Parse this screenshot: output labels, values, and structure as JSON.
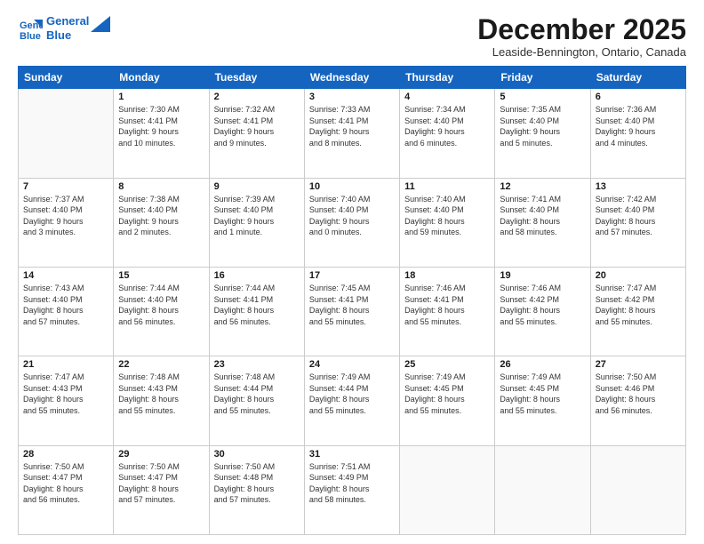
{
  "logo": {
    "line1": "General",
    "line2": "Blue"
  },
  "title": "December 2025",
  "location": "Leaside-Bennington, Ontario, Canada",
  "days_header": [
    "Sunday",
    "Monday",
    "Tuesday",
    "Wednesday",
    "Thursday",
    "Friday",
    "Saturday"
  ],
  "weeks": [
    [
      {
        "day": "",
        "info": ""
      },
      {
        "day": "1",
        "info": "Sunrise: 7:30 AM\nSunset: 4:41 PM\nDaylight: 9 hours\nand 10 minutes."
      },
      {
        "day": "2",
        "info": "Sunrise: 7:32 AM\nSunset: 4:41 PM\nDaylight: 9 hours\nand 9 minutes."
      },
      {
        "day": "3",
        "info": "Sunrise: 7:33 AM\nSunset: 4:41 PM\nDaylight: 9 hours\nand 8 minutes."
      },
      {
        "day": "4",
        "info": "Sunrise: 7:34 AM\nSunset: 4:40 PM\nDaylight: 9 hours\nand 6 minutes."
      },
      {
        "day": "5",
        "info": "Sunrise: 7:35 AM\nSunset: 4:40 PM\nDaylight: 9 hours\nand 5 minutes."
      },
      {
        "day": "6",
        "info": "Sunrise: 7:36 AM\nSunset: 4:40 PM\nDaylight: 9 hours\nand 4 minutes."
      }
    ],
    [
      {
        "day": "7",
        "info": "Sunrise: 7:37 AM\nSunset: 4:40 PM\nDaylight: 9 hours\nand 3 minutes."
      },
      {
        "day": "8",
        "info": "Sunrise: 7:38 AM\nSunset: 4:40 PM\nDaylight: 9 hours\nand 2 minutes."
      },
      {
        "day": "9",
        "info": "Sunrise: 7:39 AM\nSunset: 4:40 PM\nDaylight: 9 hours\nand 1 minute."
      },
      {
        "day": "10",
        "info": "Sunrise: 7:40 AM\nSunset: 4:40 PM\nDaylight: 9 hours\nand 0 minutes."
      },
      {
        "day": "11",
        "info": "Sunrise: 7:40 AM\nSunset: 4:40 PM\nDaylight: 8 hours\nand 59 minutes."
      },
      {
        "day": "12",
        "info": "Sunrise: 7:41 AM\nSunset: 4:40 PM\nDaylight: 8 hours\nand 58 minutes."
      },
      {
        "day": "13",
        "info": "Sunrise: 7:42 AM\nSunset: 4:40 PM\nDaylight: 8 hours\nand 57 minutes."
      }
    ],
    [
      {
        "day": "14",
        "info": "Sunrise: 7:43 AM\nSunset: 4:40 PM\nDaylight: 8 hours\nand 57 minutes."
      },
      {
        "day": "15",
        "info": "Sunrise: 7:44 AM\nSunset: 4:40 PM\nDaylight: 8 hours\nand 56 minutes."
      },
      {
        "day": "16",
        "info": "Sunrise: 7:44 AM\nSunset: 4:41 PM\nDaylight: 8 hours\nand 56 minutes."
      },
      {
        "day": "17",
        "info": "Sunrise: 7:45 AM\nSunset: 4:41 PM\nDaylight: 8 hours\nand 55 minutes."
      },
      {
        "day": "18",
        "info": "Sunrise: 7:46 AM\nSunset: 4:41 PM\nDaylight: 8 hours\nand 55 minutes."
      },
      {
        "day": "19",
        "info": "Sunrise: 7:46 AM\nSunset: 4:42 PM\nDaylight: 8 hours\nand 55 minutes."
      },
      {
        "day": "20",
        "info": "Sunrise: 7:47 AM\nSunset: 4:42 PM\nDaylight: 8 hours\nand 55 minutes."
      }
    ],
    [
      {
        "day": "21",
        "info": "Sunrise: 7:47 AM\nSunset: 4:43 PM\nDaylight: 8 hours\nand 55 minutes."
      },
      {
        "day": "22",
        "info": "Sunrise: 7:48 AM\nSunset: 4:43 PM\nDaylight: 8 hours\nand 55 minutes."
      },
      {
        "day": "23",
        "info": "Sunrise: 7:48 AM\nSunset: 4:44 PM\nDaylight: 8 hours\nand 55 minutes."
      },
      {
        "day": "24",
        "info": "Sunrise: 7:49 AM\nSunset: 4:44 PM\nDaylight: 8 hours\nand 55 minutes."
      },
      {
        "day": "25",
        "info": "Sunrise: 7:49 AM\nSunset: 4:45 PM\nDaylight: 8 hours\nand 55 minutes."
      },
      {
        "day": "26",
        "info": "Sunrise: 7:49 AM\nSunset: 4:45 PM\nDaylight: 8 hours\nand 55 minutes."
      },
      {
        "day": "27",
        "info": "Sunrise: 7:50 AM\nSunset: 4:46 PM\nDaylight: 8 hours\nand 56 minutes."
      }
    ],
    [
      {
        "day": "28",
        "info": "Sunrise: 7:50 AM\nSunset: 4:47 PM\nDaylight: 8 hours\nand 56 minutes."
      },
      {
        "day": "29",
        "info": "Sunrise: 7:50 AM\nSunset: 4:47 PM\nDaylight: 8 hours\nand 57 minutes."
      },
      {
        "day": "30",
        "info": "Sunrise: 7:50 AM\nSunset: 4:48 PM\nDaylight: 8 hours\nand 57 minutes."
      },
      {
        "day": "31",
        "info": "Sunrise: 7:51 AM\nSunset: 4:49 PM\nDaylight: 8 hours\nand 58 minutes."
      },
      {
        "day": "",
        "info": ""
      },
      {
        "day": "",
        "info": ""
      },
      {
        "day": "",
        "info": ""
      }
    ]
  ]
}
